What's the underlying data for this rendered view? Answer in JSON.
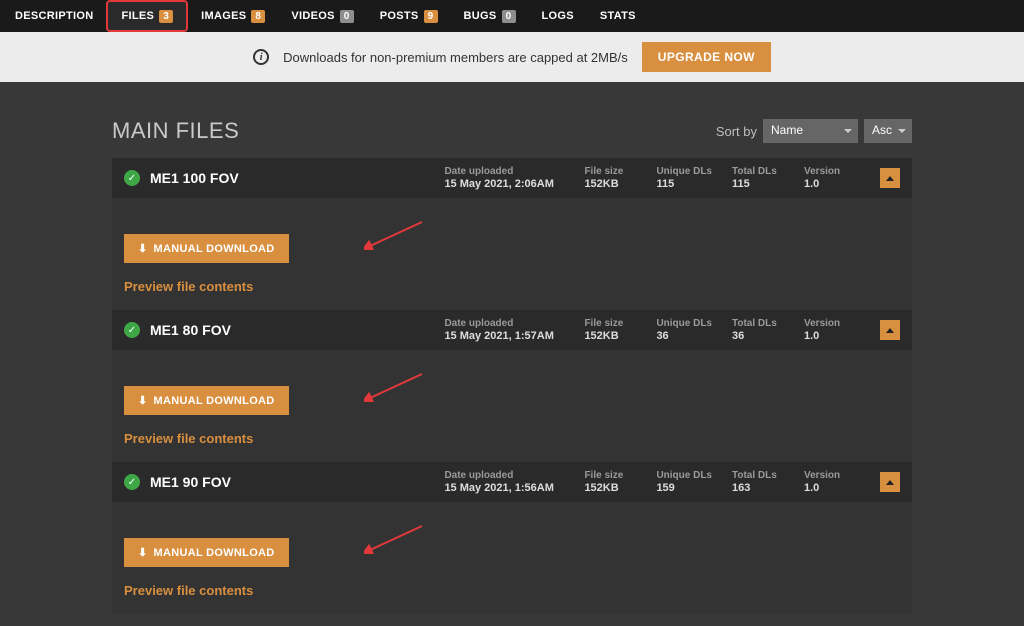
{
  "tabs": [
    {
      "label": "DESCRIPTION",
      "count": null
    },
    {
      "label": "FILES",
      "count": "3",
      "active": true
    },
    {
      "label": "IMAGES",
      "count": "8"
    },
    {
      "label": "VIDEOS",
      "count": "0",
      "zero": true
    },
    {
      "label": "POSTS",
      "count": "9"
    },
    {
      "label": "BUGS",
      "count": "0",
      "zero": true
    },
    {
      "label": "LOGS",
      "count": null
    },
    {
      "label": "STATS",
      "count": null
    }
  ],
  "banner": {
    "message": "Downloads for non-premium members are capped at 2MB/s",
    "button": "UPGRADE NOW"
  },
  "section_title": "MAIN FILES",
  "sort": {
    "label": "Sort by",
    "field": "Name",
    "dir": "Asc"
  },
  "meta_labels": {
    "date": "Date uploaded",
    "size": "File size",
    "unique": "Unique DLs",
    "total": "Total DLs",
    "version": "Version"
  },
  "download_label": "MANUAL DOWNLOAD",
  "preview_label": "Preview file contents",
  "files": [
    {
      "name": "ME1 100 FOV",
      "date": "15 May 2021, 2:06AM",
      "size": "152KB",
      "unique": "115",
      "total": "115",
      "version": "1.0"
    },
    {
      "name": "ME1 80 FOV",
      "date": "15 May 2021, 1:57AM",
      "size": "152KB",
      "unique": "36",
      "total": "36",
      "version": "1.0"
    },
    {
      "name": "ME1 90 FOV",
      "date": "15 May 2021, 1:56AM",
      "size": "152KB",
      "unique": "159",
      "total": "163",
      "version": "1.0"
    }
  ]
}
